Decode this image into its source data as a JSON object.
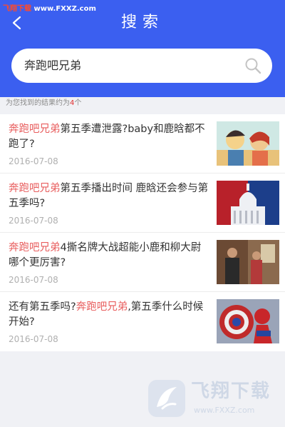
{
  "watermark_top": {
    "part1": "飞翔下载",
    "part2": " www.FXXZ.com"
  },
  "header": {
    "title": "搜索"
  },
  "search": {
    "value": "奔跑吧兄弟"
  },
  "results": {
    "count_prefix": "为您找到的结果约为",
    "count": "4",
    "count_suffix": "个",
    "items": [
      {
        "highlight": "奔跑吧兄弟",
        "before": "",
        "after": "第五季遭泄露?baby和鹿晗都不跑了?",
        "date": "2016-07-08"
      },
      {
        "highlight": "奔跑吧兄弟",
        "before": "",
        "after": "第五季播出时间 鹿晗还会参与第五季吗?",
        "date": "2016-07-08"
      },
      {
        "highlight": "奔跑吧兄弟",
        "before": "",
        "after": "4撕名牌大战超能小鹿和柳大尉哪个更厉害?",
        "date": "2016-07-08"
      },
      {
        "highlight": "奔跑吧兄弟",
        "before": "还有第五季吗?",
        "after": ",第五季什么时候开始?",
        "date": "2016-07-08"
      }
    ]
  },
  "watermark_bottom": {
    "text": "飞翔下载",
    "url": "www.FXXZ.com"
  },
  "colors": {
    "header_bg": "#3b5ff0",
    "highlight": "#e85d5d",
    "page_bg": "#f0f1f5"
  },
  "icons": {
    "back": "chevron-left-icon",
    "search": "search-icon"
  }
}
